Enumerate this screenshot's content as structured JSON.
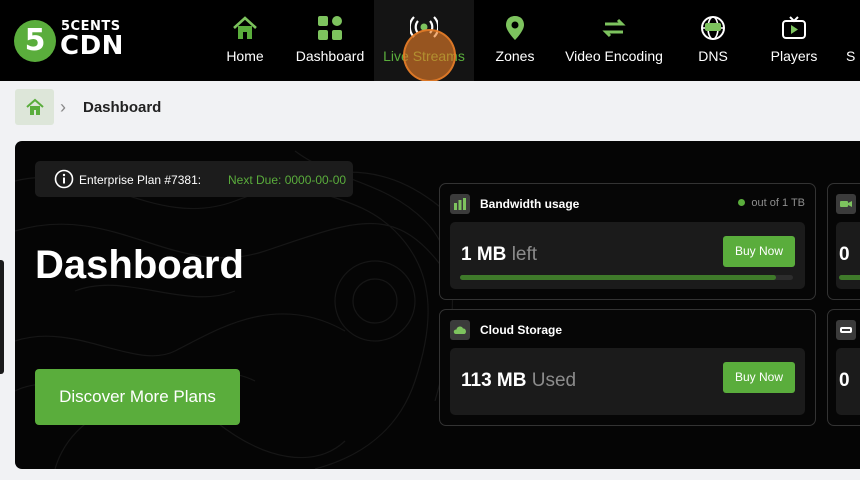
{
  "brand": {
    "badge": "5",
    "line1": "5CENTS",
    "line2": "CDN",
    "accent": "#5aad3c"
  },
  "nav": {
    "items": [
      {
        "label": "Home",
        "icon": "home-icon"
      },
      {
        "label": "Dashboard",
        "icon": "dashboard-grid-icon"
      },
      {
        "label": "Live Streams",
        "icon": "broadcast-icon",
        "active": true
      },
      {
        "label": "Zones",
        "icon": "location-pin-icon"
      },
      {
        "label": "Video Encoding",
        "icon": "encoding-arrows-icon"
      },
      {
        "label": "DNS",
        "icon": "dns-globe-icon"
      },
      {
        "label": "Players",
        "icon": "tv-player-icon"
      },
      {
        "label": "S",
        "icon": "none"
      }
    ]
  },
  "breadcrumb": {
    "home_icon": "home-icon",
    "separator": "›",
    "current": "Dashboard"
  },
  "plan": {
    "name": "Enterprise Plan #7381:",
    "due": "Next Due: 0000-00-00"
  },
  "page_title": "Dashboard",
  "discover_label": "Discover More Plans",
  "cards": {
    "bandwidth": {
      "title": "Bandwidth usage",
      "icon": "bandwidth-bars-icon",
      "meta": "out of 1 TB",
      "value": "1 MB",
      "unit": "left",
      "buy": "Buy Now",
      "progress": 0.95
    },
    "storage": {
      "title": "Cloud Storage",
      "icon": "cloud-storage-icon",
      "value": "113 MB",
      "unit": "Used",
      "buy": "Buy Now"
    },
    "partial_top": {
      "icon": "video-camera-icon",
      "value": "0"
    },
    "partial_bottom": {
      "icon": "drive-icon",
      "value": "0"
    }
  }
}
